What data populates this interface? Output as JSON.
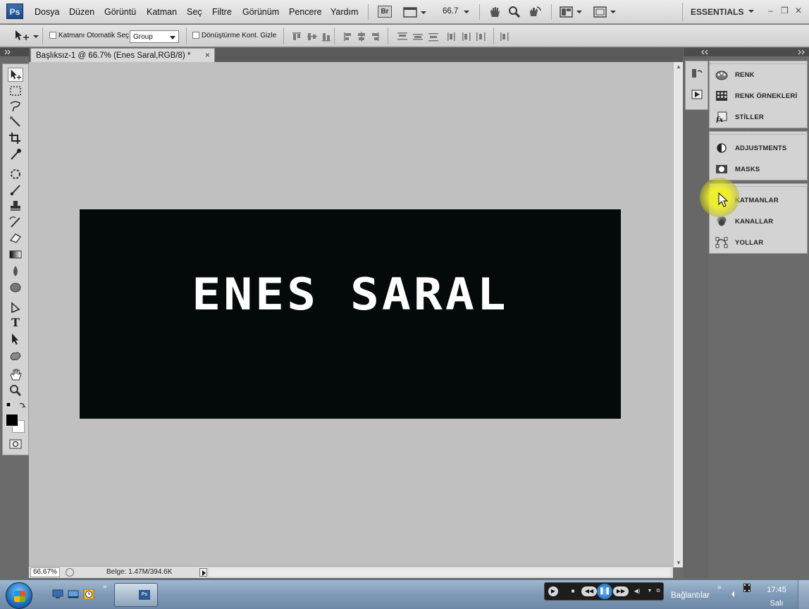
{
  "app": {
    "logo": "Ps",
    "menu": [
      "Dosya",
      "Düzen",
      "Görüntü",
      "Katman",
      "Seç",
      "Filtre",
      "Görünüm",
      "Pencere",
      "Yardım"
    ],
    "bridge_label": "Br",
    "zoom_value": "66.7",
    "workspace": "ESSENTIALS",
    "window_controls": [
      "–",
      "❐",
      "✕"
    ]
  },
  "options": {
    "auto_select_label": "Katmanı Otomatik Seç",
    "auto_select_value": "Group",
    "transform_label": "Dönüştürme Kont. Gizle"
  },
  "document": {
    "tab_title": "Başlıksız-1 @ 66.7% (Enes Saral,RGB/8) *",
    "close": "×",
    "canvas_text": "ENES SARAL",
    "canvas_bg_color": "#040909",
    "workspace_bg_color": "#c0c0c0"
  },
  "status": {
    "zoom": "66.67%",
    "doc_size": "Belge: 1.47M/394.6K"
  },
  "panels": {
    "group1": [
      {
        "label": "RENK",
        "icon": "color-palette-icon"
      },
      {
        "label": "RENK ÖRNEKLERİ",
        "icon": "swatches-grid-icon"
      },
      {
        "label": "STİLLER",
        "icon": "styles-fx-icon"
      }
    ],
    "group2": [
      {
        "label": "ADJUSTMENTS",
        "icon": "adjustments-icon"
      },
      {
        "label": "MASKS",
        "icon": "masks-icon"
      }
    ],
    "group3": [
      {
        "label": "KATMANLAR",
        "icon": "layers-icon"
      },
      {
        "label": "KANALLAR",
        "icon": "channels-icon"
      },
      {
        "label": "YOLLAR",
        "icon": "paths-icon"
      }
    ]
  },
  "taskbar": {
    "tray_label": "Bağlantılar",
    "chevron": "»",
    "time": "17:45",
    "day": "Salı",
    "task_icon": "Ps"
  }
}
